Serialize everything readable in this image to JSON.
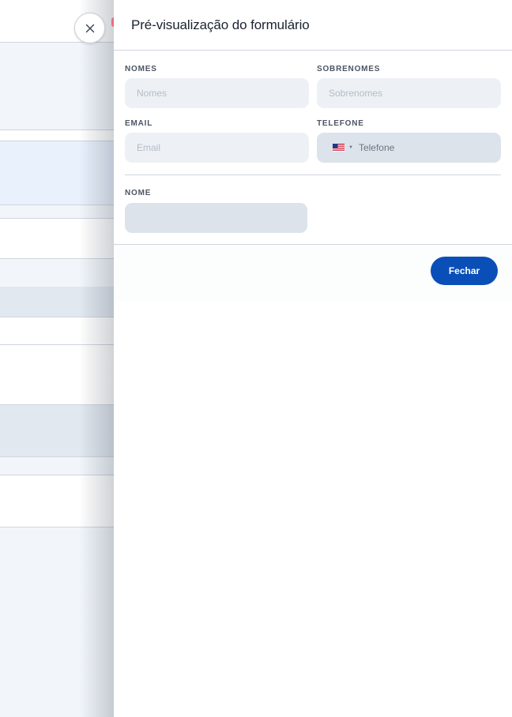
{
  "drawer": {
    "title": "Pré-visualização do formulário"
  },
  "form": {
    "fields": [
      {
        "label": "NOMES",
        "placeholder": "Nomes",
        "value": ""
      },
      {
        "label": "SOBRENOMES",
        "placeholder": "Sobrenomes",
        "value": ""
      },
      {
        "label": "EMAIL",
        "placeholder": "Email",
        "value": ""
      },
      {
        "label": "TELEFONE",
        "placeholder": "Telefone",
        "value": "",
        "country_flag": "us-flag-icon"
      },
      {
        "label": "NOME",
        "placeholder": "",
        "value": ""
      }
    ]
  },
  "footer": {
    "close_label": "Fechar"
  },
  "colors": {
    "primary_button": "#0a4fb8",
    "input_bg": "#edf1f5",
    "input_bg_dark": "#dce3eb"
  }
}
